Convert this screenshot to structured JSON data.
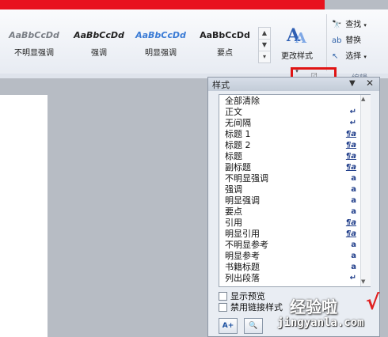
{
  "ribbon": {
    "styles_gallery": [
      {
        "sample": "AaBbCcDd",
        "name": "不明显强调",
        "color": "#7a7f86",
        "italic": true
      },
      {
        "sample": "AaBbCcDd",
        "name": "强调",
        "color": "#222222",
        "italic": true
      },
      {
        "sample": "AaBbCcDd",
        "name": "明显强调",
        "color": "#3a7bd5",
        "italic": true
      },
      {
        "sample": "AaBbCcDd",
        "name": "要点",
        "color": "#222222",
        "italic": false
      }
    ],
    "change_styles_label": "更改样式",
    "find_label": "查找",
    "replace_label": "替换",
    "select_label": "选择",
    "edit_group_label": "编辑"
  },
  "pane": {
    "title": "样式",
    "styles": [
      {
        "name": "全部清除",
        "icon": ""
      },
      {
        "name": "正文",
        "icon": "↵"
      },
      {
        "name": "无间隔",
        "icon": "↵"
      },
      {
        "name": "标题 1",
        "icon": "¶a"
      },
      {
        "name": "标题 2",
        "icon": "¶a"
      },
      {
        "name": "标题",
        "icon": "¶a"
      },
      {
        "name": "副标题",
        "icon": "¶a"
      },
      {
        "name": "不明显强调",
        "icon": "a"
      },
      {
        "name": "强调",
        "icon": "a"
      },
      {
        "name": "明显强调",
        "icon": "a"
      },
      {
        "name": "要点",
        "icon": "a"
      },
      {
        "name": "引用",
        "icon": "¶a"
      },
      {
        "name": "明显引用",
        "icon": "¶a"
      },
      {
        "name": "不明显参考",
        "icon": "a"
      },
      {
        "name": "明显参考",
        "icon": "a"
      },
      {
        "name": "书籍标题",
        "icon": "a"
      },
      {
        "name": "列出段落",
        "icon": "↵"
      }
    ],
    "show_preview_label": "显示预览",
    "disable_linked_label": "禁用链接样式"
  },
  "watermark": {
    "text": "经验啦",
    "url": "jingyanla.com",
    "check": "√"
  },
  "colors": {
    "annotation_red": "#e01414",
    "icon_blue": "#1f3d8a"
  }
}
